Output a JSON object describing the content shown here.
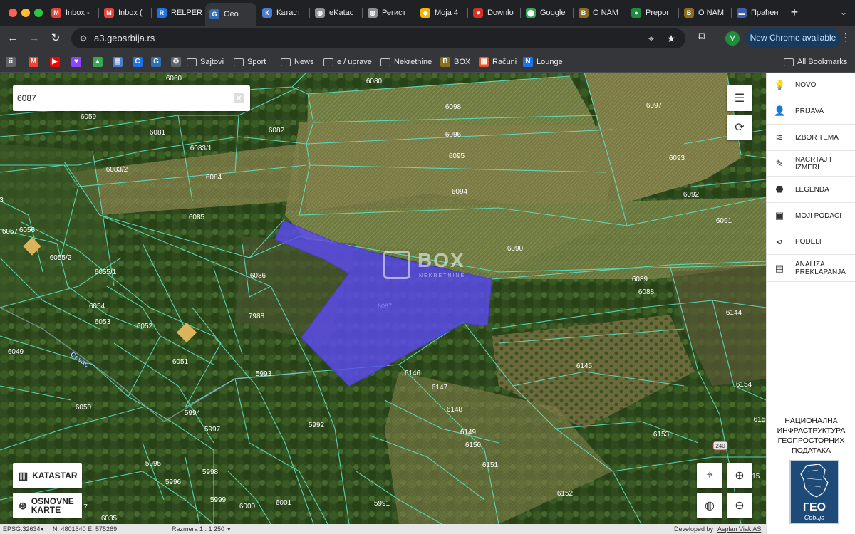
{
  "browser": {
    "tabs": [
      {
        "title": "Inbox -",
        "icon": "gmail-icon",
        "color": "#ea4335",
        "glyph": "M"
      },
      {
        "title": "Inbox (",
        "icon": "gmail-icon",
        "color": "#ea4335",
        "glyph": "M"
      },
      {
        "title": "RELPER",
        "icon": "relper-icon",
        "color": "#1a73e8",
        "glyph": "R"
      },
      {
        "title": "Geo",
        "icon": "geosrbija-icon",
        "color": "#2f6db5",
        "glyph": "G"
      },
      {
        "title": "Катаст",
        "icon": "document-icon",
        "color": "#4a7bd0",
        "glyph": "К"
      },
      {
        "title": "eKatac",
        "icon": "globe-icon",
        "color": "#8e9094",
        "glyph": "◍"
      },
      {
        "title": "Регист",
        "icon": "globe-icon",
        "color": "#8e9094",
        "glyph": "◍"
      },
      {
        "title": "Moja 4",
        "icon": "moja-icon",
        "color": "#f4b400",
        "glyph": "◆"
      },
      {
        "title": "Downlo",
        "icon": "heart-icon",
        "color": "#d93025",
        "glyph": "♥"
      },
      {
        "title": "Google",
        "icon": "maps-pin-icon",
        "color": "#34a853",
        "glyph": "⬤"
      },
      {
        "title": "O NAM",
        "icon": "box-icon",
        "color": "#8b6d1e",
        "glyph": "B"
      },
      {
        "title": "Prepor",
        "icon": "prepor-icon",
        "color": "#1e8e3e",
        "glyph": "●"
      },
      {
        "title": "O NAM",
        "icon": "box-icon",
        "color": "#8b6d1e",
        "glyph": "B"
      },
      {
        "title": "Праћен",
        "icon": "flag-icon",
        "color": "#3c5fa8",
        "glyph": "▬"
      }
    ],
    "url": "a3.geosrbija.rs",
    "update_label": "New Chrome available",
    "profile_initial": "V",
    "bookmarks": [
      {
        "label": "",
        "icon": "apps-grid-icon",
        "color": "#5f6368",
        "glyph": "⠿"
      },
      {
        "label": "",
        "icon": "gmail-icon",
        "color": "#ea4335",
        "glyph": "M"
      },
      {
        "label": "",
        "icon": "youtube-icon",
        "color": "#ff0000",
        "glyph": "▶"
      },
      {
        "label": "",
        "icon": "heart-purple-icon",
        "color": "#8e44ff",
        "glyph": "♥"
      },
      {
        "label": "",
        "icon": "drive-icon",
        "color": "#34a853",
        "glyph": "▲"
      },
      {
        "label": "",
        "icon": "docs-icon",
        "color": "#4a7bd0",
        "glyph": "▤"
      },
      {
        "label": "",
        "icon": "c-icon",
        "color": "#1a73e8",
        "glyph": "C"
      },
      {
        "label": "",
        "icon": "geosrbija-icon",
        "color": "#2f6db5",
        "glyph": "G"
      },
      {
        "label": "",
        "icon": "openai-icon",
        "color": "#5f6368",
        "glyph": "⚙"
      },
      {
        "label": "Sajtovi",
        "icon": "folder-icon"
      },
      {
        "label": "Sport",
        "icon": "folder-icon"
      },
      {
        "label": "News",
        "icon": "folder-icon"
      },
      {
        "label": "e / uprave",
        "icon": "folder-icon"
      },
      {
        "label": "Nekretnine",
        "icon": "folder-icon"
      },
      {
        "label": "BOX",
        "icon": "box-icon",
        "color": "#8b6d1e",
        "glyph": "B"
      },
      {
        "label": "Računi",
        "icon": "microsoft-icon",
        "color": "#f25022",
        "glyph": "▦"
      },
      {
        "label": "Lounge",
        "icon": "lounge-icon",
        "color": "#1a73e8",
        "glyph": "N"
      }
    ],
    "all_bookmarks_label": "All Bookmarks"
  },
  "map": {
    "search_value": "6087",
    "watermark_text": "BOX",
    "watermark_sub": "NEKRETNINE",
    "selected_parcel": "6087",
    "parcels": [
      {
        "n": "6060"
      },
      {
        "n": "6080"
      },
      {
        "n": "6098"
      },
      {
        "n": "6097"
      },
      {
        "n": "6059"
      },
      {
        "n": "6081"
      },
      {
        "n": "6082"
      },
      {
        "n": "6096"
      },
      {
        "n": "6083/1"
      },
      {
        "n": "6095"
      },
      {
        "n": "6093"
      },
      {
        "n": "6083/2"
      },
      {
        "n": "6084"
      },
      {
        "n": "6094"
      },
      {
        "n": "6092"
      },
      {
        "n": "6085"
      },
      {
        "n": "6091"
      },
      {
        "n": "6057"
      },
      {
        "n": "6056"
      },
      {
        "n": "6055/2"
      },
      {
        "n": "6090"
      },
      {
        "n": "6055/1"
      },
      {
        "n": "6086"
      },
      {
        "n": "6089"
      },
      {
        "n": "6088"
      },
      {
        "n": "6054"
      },
      {
        "n": "7988"
      },
      {
        "n": "6144"
      },
      {
        "n": "6053"
      },
      {
        "n": "6052"
      },
      {
        "n": "6049"
      },
      {
        "n": "6051"
      },
      {
        "n": "5993"
      },
      {
        "n": "6146"
      },
      {
        "n": "6145"
      },
      {
        "n": "6147"
      },
      {
        "n": "6154"
      },
      {
        "n": "6050"
      },
      {
        "n": "5994"
      },
      {
        "n": "6148"
      },
      {
        "n": "5997"
      },
      {
        "n": "5992"
      },
      {
        "n": "6149"
      },
      {
        "n": "6153"
      },
      {
        "n": "6150"
      },
      {
        "n": "5995"
      },
      {
        "n": "6151"
      },
      {
        "n": "5998"
      },
      {
        "n": "5996"
      },
      {
        "n": "6152"
      },
      {
        "n": "5999"
      },
      {
        "n": "6000"
      },
      {
        "n": "6001"
      },
      {
        "n": "5991"
      },
      {
        "n": "6035"
      },
      {
        "n": "615"
      },
      {
        "n": "615"
      },
      {
        "n": "7"
      },
      {
        "n": "3"
      }
    ],
    "road_label": "Čevac",
    "road_number": "240",
    "layer_buttons": {
      "katastar": "KATASTAR",
      "osnovne": "OSNOVNE KARTE"
    }
  },
  "status": {
    "epsg": "EPSG:32634",
    "coords": "N: 4801640 E: 575269",
    "scale": "Razmera 1 : 1 250",
    "developed": "Developed by",
    "developer": "Asplan Viak AS"
  },
  "panel": {
    "items": [
      {
        "label": "NOVO",
        "icon": "lightbulb-icon",
        "glyph": "💡"
      },
      {
        "label": "PRIJAVA",
        "icon": "user-icon",
        "glyph": "👤"
      },
      {
        "label": "IZBOR TEMA",
        "icon": "layers-icon",
        "glyph": "≋"
      },
      {
        "label": "NACRTAJ I IZMERI",
        "icon": "pencil-icon",
        "glyph": "✎"
      },
      {
        "label": "LEGENDA",
        "icon": "tag-icon",
        "glyph": "⬣"
      },
      {
        "label": "MOJI PODACI",
        "icon": "briefcase-icon",
        "glyph": "▣"
      },
      {
        "label": "PODELI",
        "icon": "share-icon",
        "glyph": "⋖"
      },
      {
        "label": "ANALIZA PREKLAPANJA",
        "icon": "clipboard-icon",
        "glyph": "▤"
      }
    ],
    "geo_title": "НАЦИОНАЛНА ИНФРАСТРУКТУРА ГЕОПРОСТОРНИХ ПОДАТАКА",
    "geo_logo_text": "ГЕО",
    "geo_logo_sub": "Србија"
  },
  "colors": {
    "selection": "#5b4bf0",
    "parcel_line": "#5fe0c0",
    "chrome_dark": "#202124"
  }
}
